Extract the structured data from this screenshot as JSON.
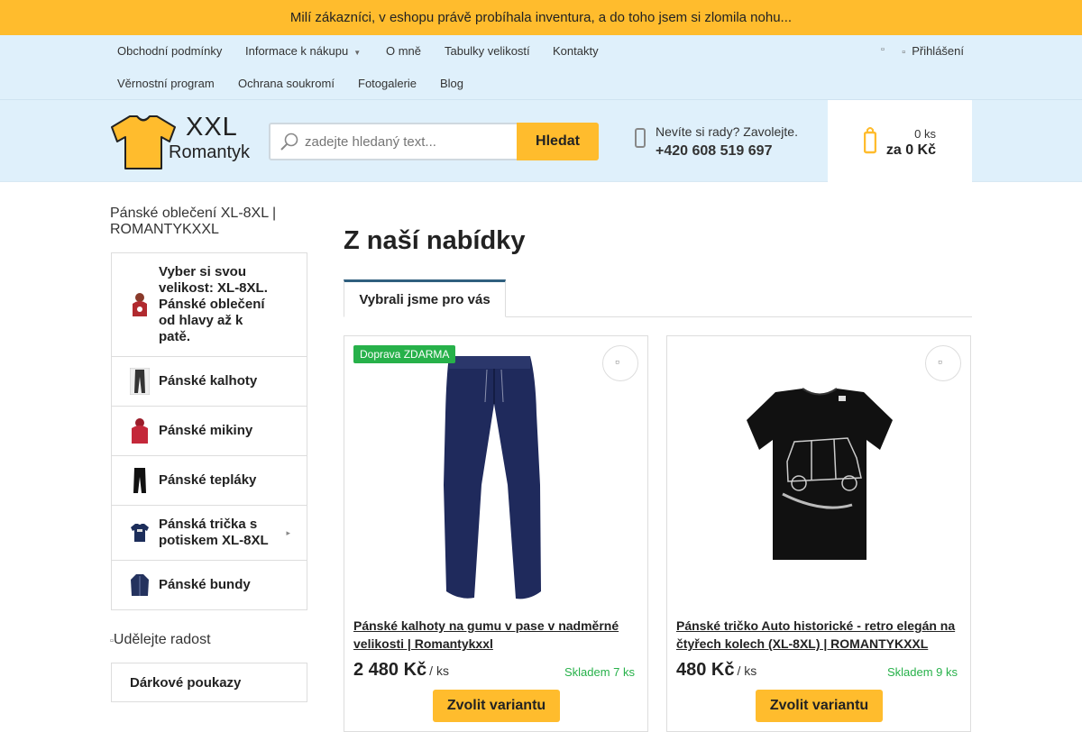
{
  "banner": {
    "text": "Milí zákazníci, v eshopu právě probíhala inventura, a do toho jsem si zlomila nohu..."
  },
  "nav": {
    "row1": [
      "Obchodní podmínky",
      "Informace k nákupu",
      "O mně",
      "Tabulky velikostí",
      "Kontakty"
    ],
    "row2": [
      "Věrnostní program",
      "Ochrana soukromí",
      "Fotogalerie",
      "Blog"
    ],
    "login": "Přihlášení"
  },
  "logo": {
    "top": "XXL",
    "bottom": "Romantyk"
  },
  "search": {
    "placeholder": "zadejte hledaný text...",
    "button": "Hledat"
  },
  "help": {
    "question": "Nevíte si rady? Zavolejte.",
    "phone": "+420 608 519 697"
  },
  "cart": {
    "count": "0 ks",
    "total": "za 0 Kč"
  },
  "sidebar": {
    "title": "Pánské oblečení XL-8XL | ROMANTYKXXL",
    "categories": [
      {
        "label": "Vyber si svou velikost: XL-8XL. Pánské oblečení od hlavy až k patě."
      },
      {
        "label": "Pánské kalhoty"
      },
      {
        "label": "Pánské mikiny"
      },
      {
        "label": "Pánské tepláky"
      },
      {
        "label": "Pánská trička s potiskem XL-8XL"
      },
      {
        "label": "Pánské bundy"
      }
    ],
    "gift_heading": "Udělejte radost",
    "gift_item": "Dárkové poukazy"
  },
  "main": {
    "title": "Z naší nabídky",
    "tab": "Vybrali jsme pro vás",
    "products": [
      {
        "badge": "Doprava ZDARMA",
        "name": "Pánské kalhoty na gumu v pase v nadměrné velikosti | Romantykxxl",
        "price": "2 480 Kč",
        "unit": "/ ks",
        "stock": "Skladem 7 ks",
        "button": "Zvolit variantu"
      },
      {
        "badge": "",
        "name": "Pánské tričko Auto historické - retro elegán na čtyřech kolech (XL-8XL) | ROMANTYKXXL",
        "price": "480 Kč",
        "unit": "/ ks",
        "stock": "Skladem 9 ks",
        "button": "Zvolit variantu"
      }
    ]
  },
  "colors": {
    "accent": "#ffbc2d",
    "nav_bg": "#dff0fb",
    "stock": "#27b14a",
    "tab_border": "#2f5f7e"
  }
}
